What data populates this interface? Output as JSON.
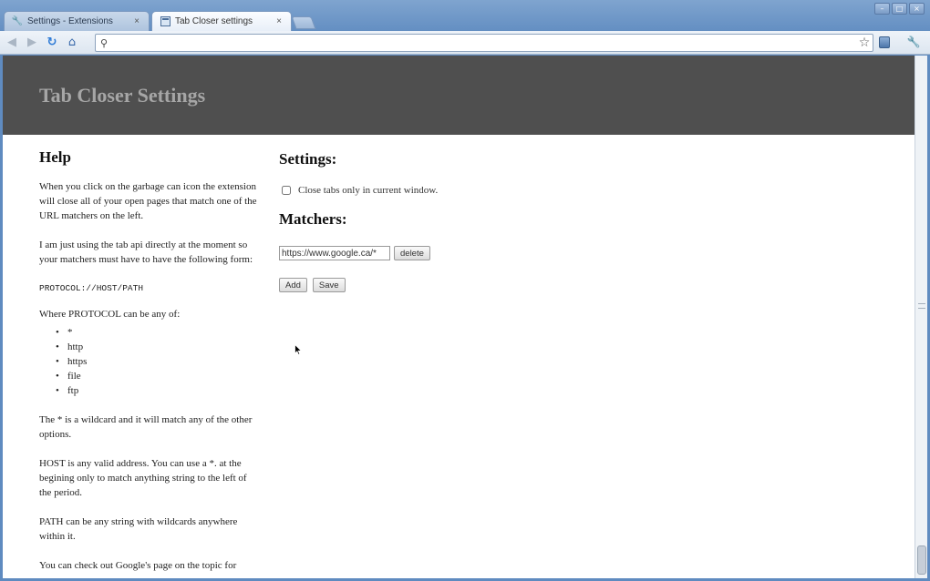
{
  "tabs": [
    {
      "label": "Settings - Extensions",
      "icon": "wrench-icon",
      "close": "×"
    },
    {
      "label": "Tab Closer settings",
      "icon": "page-icon",
      "close": "×"
    }
  ],
  "window_controls": {
    "minimize": "–",
    "maximize": "□",
    "close": "×"
  },
  "toolbar": {
    "back": "◀",
    "forward": "▶",
    "reload": "↻",
    "home": "⌂",
    "omnibox_value": "",
    "search_glyph": "⚲",
    "star": "☆",
    "wrench": "🔧"
  },
  "page": {
    "title": "Tab Closer Settings",
    "help": {
      "heading": "Help",
      "p1": "When you click on the garbage can icon the extension will close all of your open pages that match one of the URL matchers on the left.",
      "p2": "I am just using the tab api directly at the moment so your matchers must have to have the following form:",
      "code": "PROTOCOL://HOST/PATH",
      "p3": "Where PROTOCOL can be any of:",
      "protocols": [
        "*",
        "http",
        "https",
        "file",
        "ftp"
      ],
      "p4": "The * is a wildcard and it will match any of the other options.",
      "p5": "HOST is any valid address. You can use a *. at the begining only to match anything string to the left of the period.",
      "p6": "PATH can be any string with wildcards anywhere within it.",
      "p7": "You can check out Google's page on the topic for"
    },
    "settings": {
      "heading": "Settings:",
      "checkbox_label": "Close tabs only in current window.",
      "matchers_heading": "Matchers:",
      "matcher_value": "https://www.google.ca/*",
      "delete_label": "delete",
      "add_label": "Add",
      "save_label": "Save"
    }
  },
  "colors": {
    "header_band": "#4f4f4f",
    "header_text": "#a6a6a6",
    "chrome_frame": "#5f8bc0"
  }
}
